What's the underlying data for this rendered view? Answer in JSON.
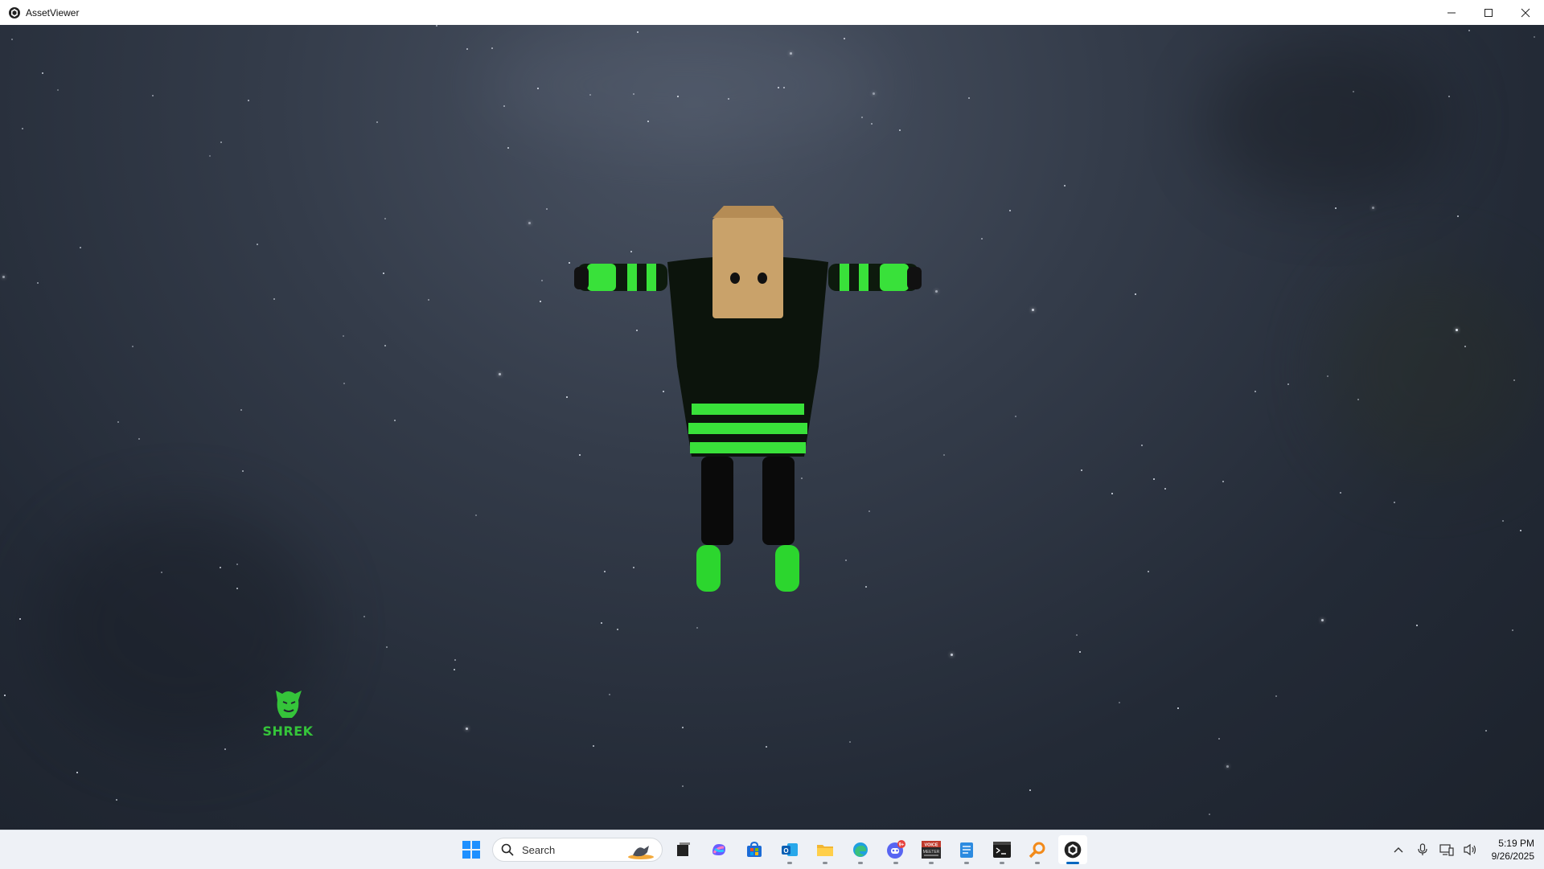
{
  "window": {
    "title": "AssetViewer",
    "minimize_symbol": "—",
    "maximize_symbol": "☐",
    "close_symbol": "✕"
  },
  "scene": {
    "model": "avatar-tpose",
    "logo_text": "SHREK",
    "accent_color": "#39e13a"
  },
  "taskbar": {
    "search_placeholder": "Search",
    "apps": [
      {
        "name": "start",
        "icon": "windows-logo-icon"
      },
      {
        "name": "task-view",
        "icon": "task-view-icon"
      },
      {
        "name": "copilot",
        "icon": "copilot-icon"
      },
      {
        "name": "store",
        "icon": "store-icon"
      },
      {
        "name": "outlook",
        "icon": "outlook-icon"
      },
      {
        "name": "file-explorer",
        "icon": "folder-icon"
      },
      {
        "name": "edge",
        "icon": "edge-icon"
      },
      {
        "name": "discord",
        "icon": "discord-icon",
        "badge": "9+"
      },
      {
        "name": "voicemeeter",
        "icon": "voicemeeter-icon"
      },
      {
        "name": "notepad",
        "icon": "notepad-icon"
      },
      {
        "name": "terminal",
        "icon": "terminal-icon"
      },
      {
        "name": "search-tool",
        "icon": "magnifier-icon"
      },
      {
        "name": "assetviewer",
        "icon": "assetviewer-icon",
        "active": true
      }
    ],
    "voicemeeter_label": "VOICE\nMEETER"
  },
  "tray": {
    "time": "5:19 PM",
    "date": "9/26/2025"
  }
}
